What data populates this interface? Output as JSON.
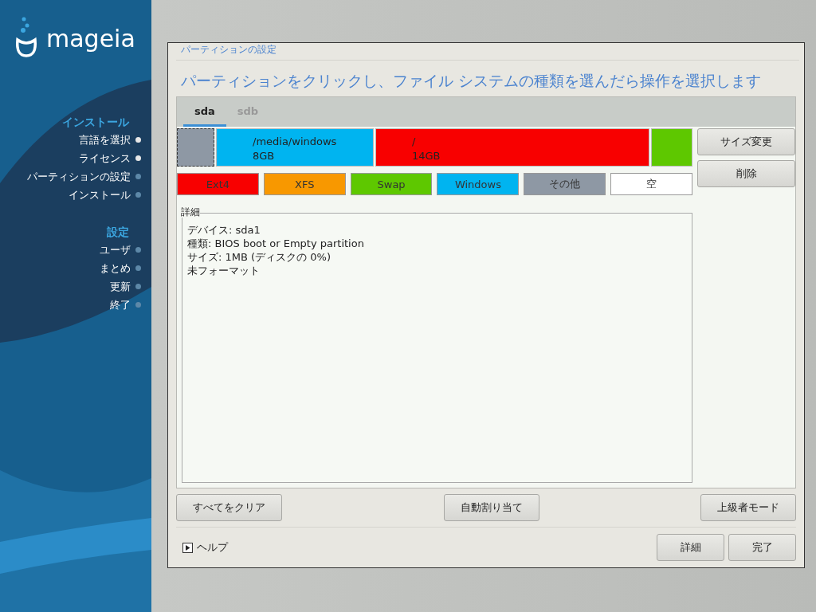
{
  "sidebar": {
    "logo": "mageia",
    "sections": [
      {
        "title": "インストール",
        "steps": [
          {
            "label": "言語を選択",
            "done": true
          },
          {
            "label": "ライセンス",
            "done": true
          },
          {
            "label": "パーティションの設定",
            "done": false
          },
          {
            "label": "インストール",
            "done": false
          }
        ]
      },
      {
        "title": "設定",
        "steps": [
          {
            "label": "ユーザ",
            "done": false
          },
          {
            "label": "まとめ",
            "done": false
          },
          {
            "label": "更新",
            "done": false
          },
          {
            "label": "終了",
            "done": false
          }
        ]
      }
    ]
  },
  "window": {
    "title": "パーティションの設定",
    "heading": "パーティションをクリックし、ファイル システムの種類を選んだら操作を選択します"
  },
  "tabs": [
    {
      "label": "sda",
      "selected": true
    },
    {
      "label": "sdb",
      "selected": false
    }
  ],
  "partitions": [
    {
      "color": "#8e98a4",
      "selected": true
    },
    {
      "lines": [
        "/media/windows",
        "8GB"
      ],
      "color": "#00b4f0",
      "selected": false
    },
    {
      "lines": [
        "/",
        "14GB"
      ],
      "color": "#f80000",
      "selected": false
    },
    {
      "color": "#5ec800",
      "selected": false
    }
  ],
  "side_buttons": [
    "サイズ変更",
    "削除"
  ],
  "legend": [
    {
      "label": "Ext4",
      "color": "#f80000"
    },
    {
      "label": "XFS",
      "color": "#f89800"
    },
    {
      "label": "Swap",
      "color": "#5ec800"
    },
    {
      "label": "Windows",
      "color": "#00b4f0"
    },
    {
      "label": "その他",
      "color": "#8e98a4"
    },
    {
      "label": "空",
      "color": "#ffffff"
    }
  ],
  "details": {
    "title": "詳細",
    "lines": [
      "デバイス: sda1",
      "種類: BIOS boot or Empty partition",
      "サイズ: 1MB (ディスクの 0%)",
      "未フォーマット"
    ]
  },
  "action_buttons": [
    "すべてをクリア",
    "自動割り当て",
    "上級者モード"
  ],
  "help": "ヘルプ",
  "footer_buttons": [
    "詳細",
    "完了"
  ]
}
